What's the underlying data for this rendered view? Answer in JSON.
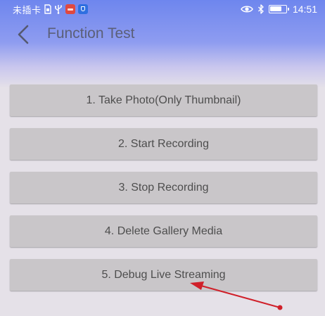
{
  "status_bar": {
    "carrier": "未插卡",
    "time": "14:51",
    "battery_level": 0.8,
    "left_icons": [
      "sim-card-icon",
      "usb-icon",
      "red-app-badge-icon",
      "blue-shield-app-icon"
    ],
    "right_icons": [
      "eye-icon",
      "bluetooth-icon",
      "battery-icon"
    ]
  },
  "app_bar": {
    "back_icon": "chevron-left-icon",
    "title": "Function Test"
  },
  "actions": [
    {
      "label": "1. Take Photo(Only Thumbnail)"
    },
    {
      "label": "2. Start Recording"
    },
    {
      "label": "3. Stop Recording"
    },
    {
      "label": "4. Delete Gallery Media"
    },
    {
      "label": "5. Debug Live Streaming"
    }
  ],
  "annotation": {
    "color": "#d0202a",
    "points_to": "5. Debug Live Streaming"
  },
  "colors": {
    "header_gradient_top": "#6e86ee",
    "background": "#e5e1e8",
    "button_bg": "#c9c6c9",
    "button_text": "#4e4e4e",
    "title_text": "#5b5f78"
  }
}
